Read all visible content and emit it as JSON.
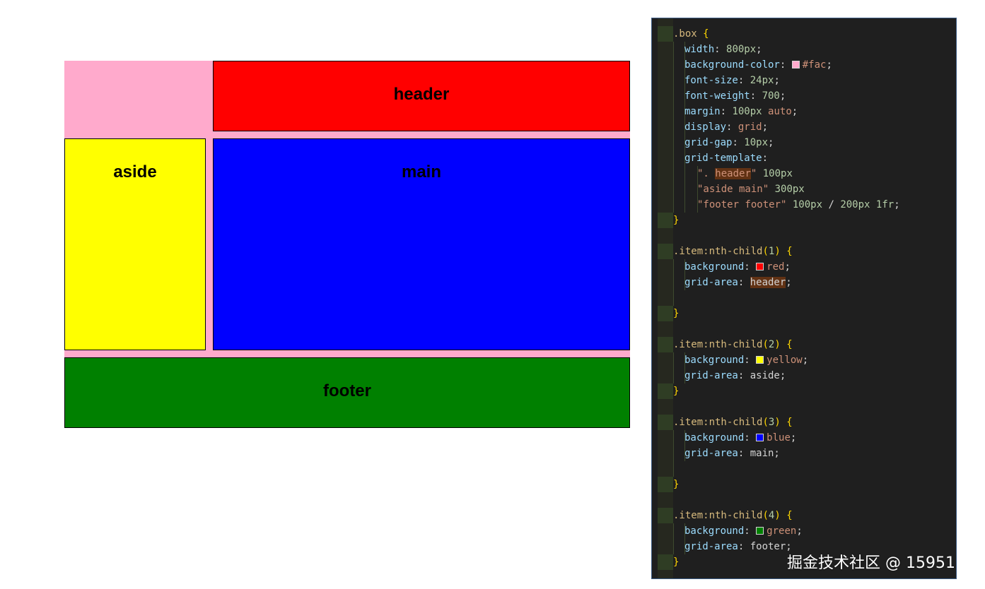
{
  "grid_demo": {
    "header": "header",
    "aside": "aside",
    "main": "main",
    "footer": "footer",
    "colors": {
      "box_background": "#ffaacc",
      "header": "#ff0000",
      "aside": "#ffff00",
      "main": "#0000ff",
      "footer": "#008000"
    }
  },
  "code": {
    "box_selector": ".box",
    "box_rules": [
      {
        "prop": "width",
        "value": "800px"
      },
      {
        "prop": "background-color",
        "value": "#fac",
        "swatch": "#ffaacc"
      },
      {
        "prop": "font-size",
        "value": "24px"
      },
      {
        "prop": "font-weight",
        "value": "700"
      },
      {
        "prop": "margin",
        "value": "100px auto"
      },
      {
        "prop": "display",
        "value": "grid"
      },
      {
        "prop": "grid-gap",
        "value": "10px"
      },
      {
        "prop": "grid-template",
        "value": ""
      }
    ],
    "template_lines": [
      "\". header\" 100px",
      "\"aside main\" 300px",
      "\"footer footer\" 100px / 200px 1fr;"
    ],
    "items": [
      {
        "selector": ".item:nth-child(1)",
        "background": "red",
        "swatch": "#ff0000",
        "area": "header"
      },
      {
        "selector": ".item:nth-child(2)",
        "background": "yellow",
        "swatch": "#ffff00",
        "area": "aside"
      },
      {
        "selector": ".item:nth-child(3)",
        "background": "blue",
        "swatch": "#0000ff",
        "area": "main"
      },
      {
        "selector": ".item:nth-child(4)",
        "background": "green",
        "swatch": "#008000",
        "area": "footer"
      }
    ]
  },
  "watermark": "掘金技术社区 @ 15951"
}
